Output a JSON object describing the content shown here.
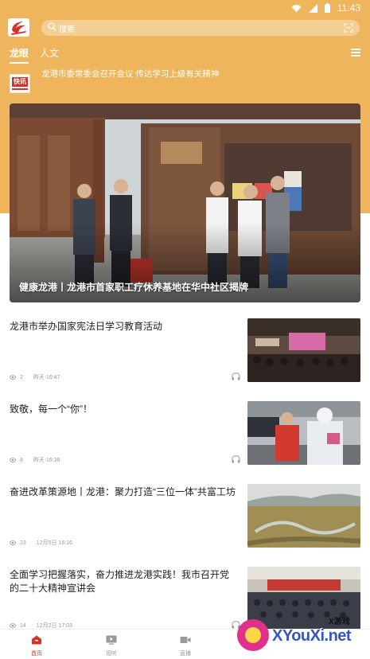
{
  "status_bar": {
    "time": "11:43"
  },
  "search": {
    "placeholder": "搜索"
  },
  "tabs": [
    {
      "label": "龙眼",
      "active": true
    },
    {
      "label": "人文",
      "active": false
    }
  ],
  "flash_news": {
    "badge": "快讯",
    "headline": "龙港市委常委会召开会议 传达学习上级有关精神"
  },
  "hero": {
    "caption": "健康龙港丨龙港市首家职工疗休养基地在华中社区揭牌"
  },
  "news": [
    {
      "title": "龙港市举办国家宪法日学习教育活动",
      "views": "2",
      "date": "昨天 16:47",
      "has_audio": true
    },
    {
      "title": "致敬，每一个“你”！",
      "views": "8",
      "date": "昨天 16:38",
      "has_audio": true
    },
    {
      "title": "奋进改革策源地丨龙港：聚力打造“三位一体”共富工坊",
      "views": "23",
      "date": "12月5日 16:16",
      "has_audio": false
    },
    {
      "title": "全面学习把握落实，奋力推进龙港实践！我市召开党的二十大精神宣讲会",
      "views": "14",
      "date": "12月2日 17:03",
      "has_audio": true
    }
  ],
  "bottom_nav": [
    {
      "label": "首页",
      "icon": "home-icon",
      "active": true
    },
    {
      "label": "视听",
      "icon": "tv-icon",
      "active": false
    },
    {
      "label": "直播",
      "icon": "video-camera-icon",
      "active": false
    }
  ],
  "watermark": {
    "small": "X游戏",
    "big": "XYouXi.net"
  },
  "colors": {
    "header": "#efb55c",
    "accent": "#d8332b",
    "meta": "#9a9a9a",
    "watermark": "#3554c8"
  }
}
